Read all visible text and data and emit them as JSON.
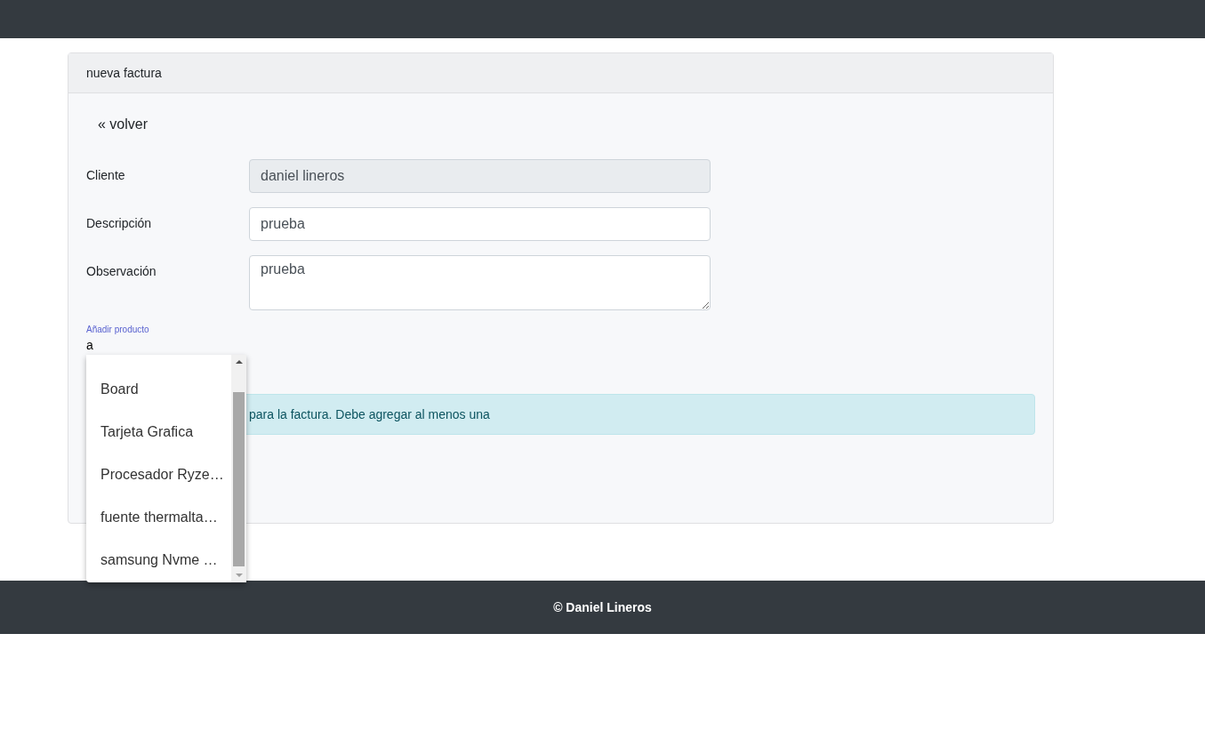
{
  "card": {
    "title": "nueva factura",
    "back_link": "« volver",
    "fields": [
      {
        "label": "Cliente",
        "value": "daniel lineros",
        "kind": "input",
        "disabled": true
      },
      {
        "label": "Descripción",
        "value": "prueba",
        "kind": "input",
        "disabled": false
      },
      {
        "label": "Observación",
        "value": "prueba",
        "kind": "textarea",
        "disabled": false
      }
    ],
    "product_search": {
      "label": "Añadir producto",
      "value": "a",
      "options": [
        "Board",
        "Tarjeta Grafica",
        "Procesador Ryze…",
        "fuente thermalta…",
        "samsung Nvme …"
      ]
    },
    "alert": "para la factura. Debe agregar al menos una"
  },
  "footer": "© Daniel Lineros"
}
